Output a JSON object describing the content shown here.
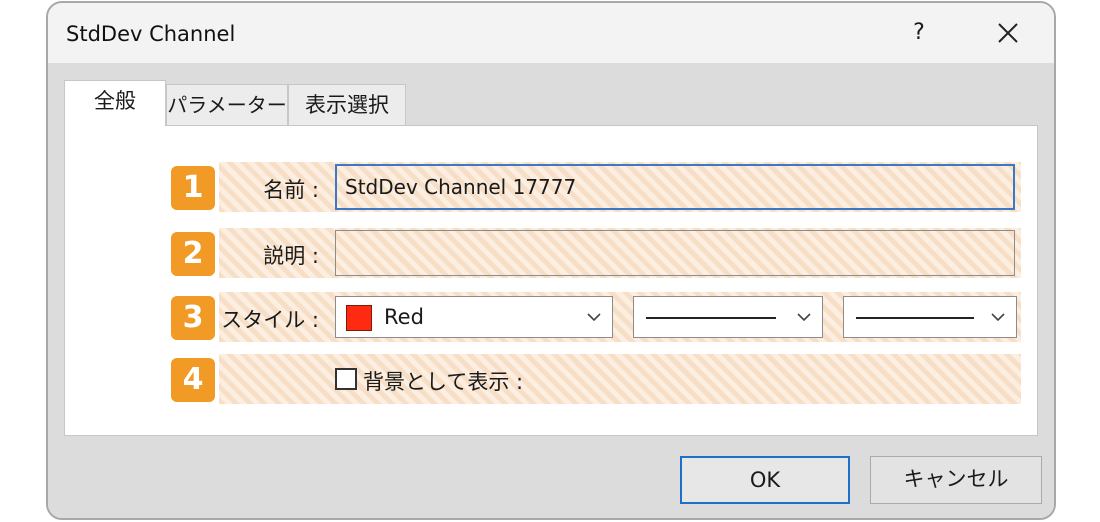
{
  "window": {
    "title": "StdDev Channel",
    "help": "?"
  },
  "tabs": [
    {
      "label": "全般",
      "active": true
    },
    {
      "label": "パラメーター",
      "active": false
    },
    {
      "label": "表示選択",
      "active": false
    }
  ],
  "rows": [
    {
      "badge": "1",
      "label": "名前 :",
      "value": "StdDev Channel 17777"
    },
    {
      "badge": "2",
      "label": "説明 :",
      "value": ""
    },
    {
      "badge": "3",
      "label": "スタイル :"
    },
    {
      "badge": "4",
      "checkbox_label": "背景として表示 :",
      "checked": false
    }
  ],
  "style": {
    "color": {
      "name": "Red",
      "swatch": "#ff2a10"
    }
  },
  "buttons": {
    "ok": "OK",
    "cancel": "キャンセル"
  },
  "colors": {
    "badge": "#f29a26",
    "accent": "#1f6fc5",
    "row_stripe": "#f6dfc6"
  }
}
